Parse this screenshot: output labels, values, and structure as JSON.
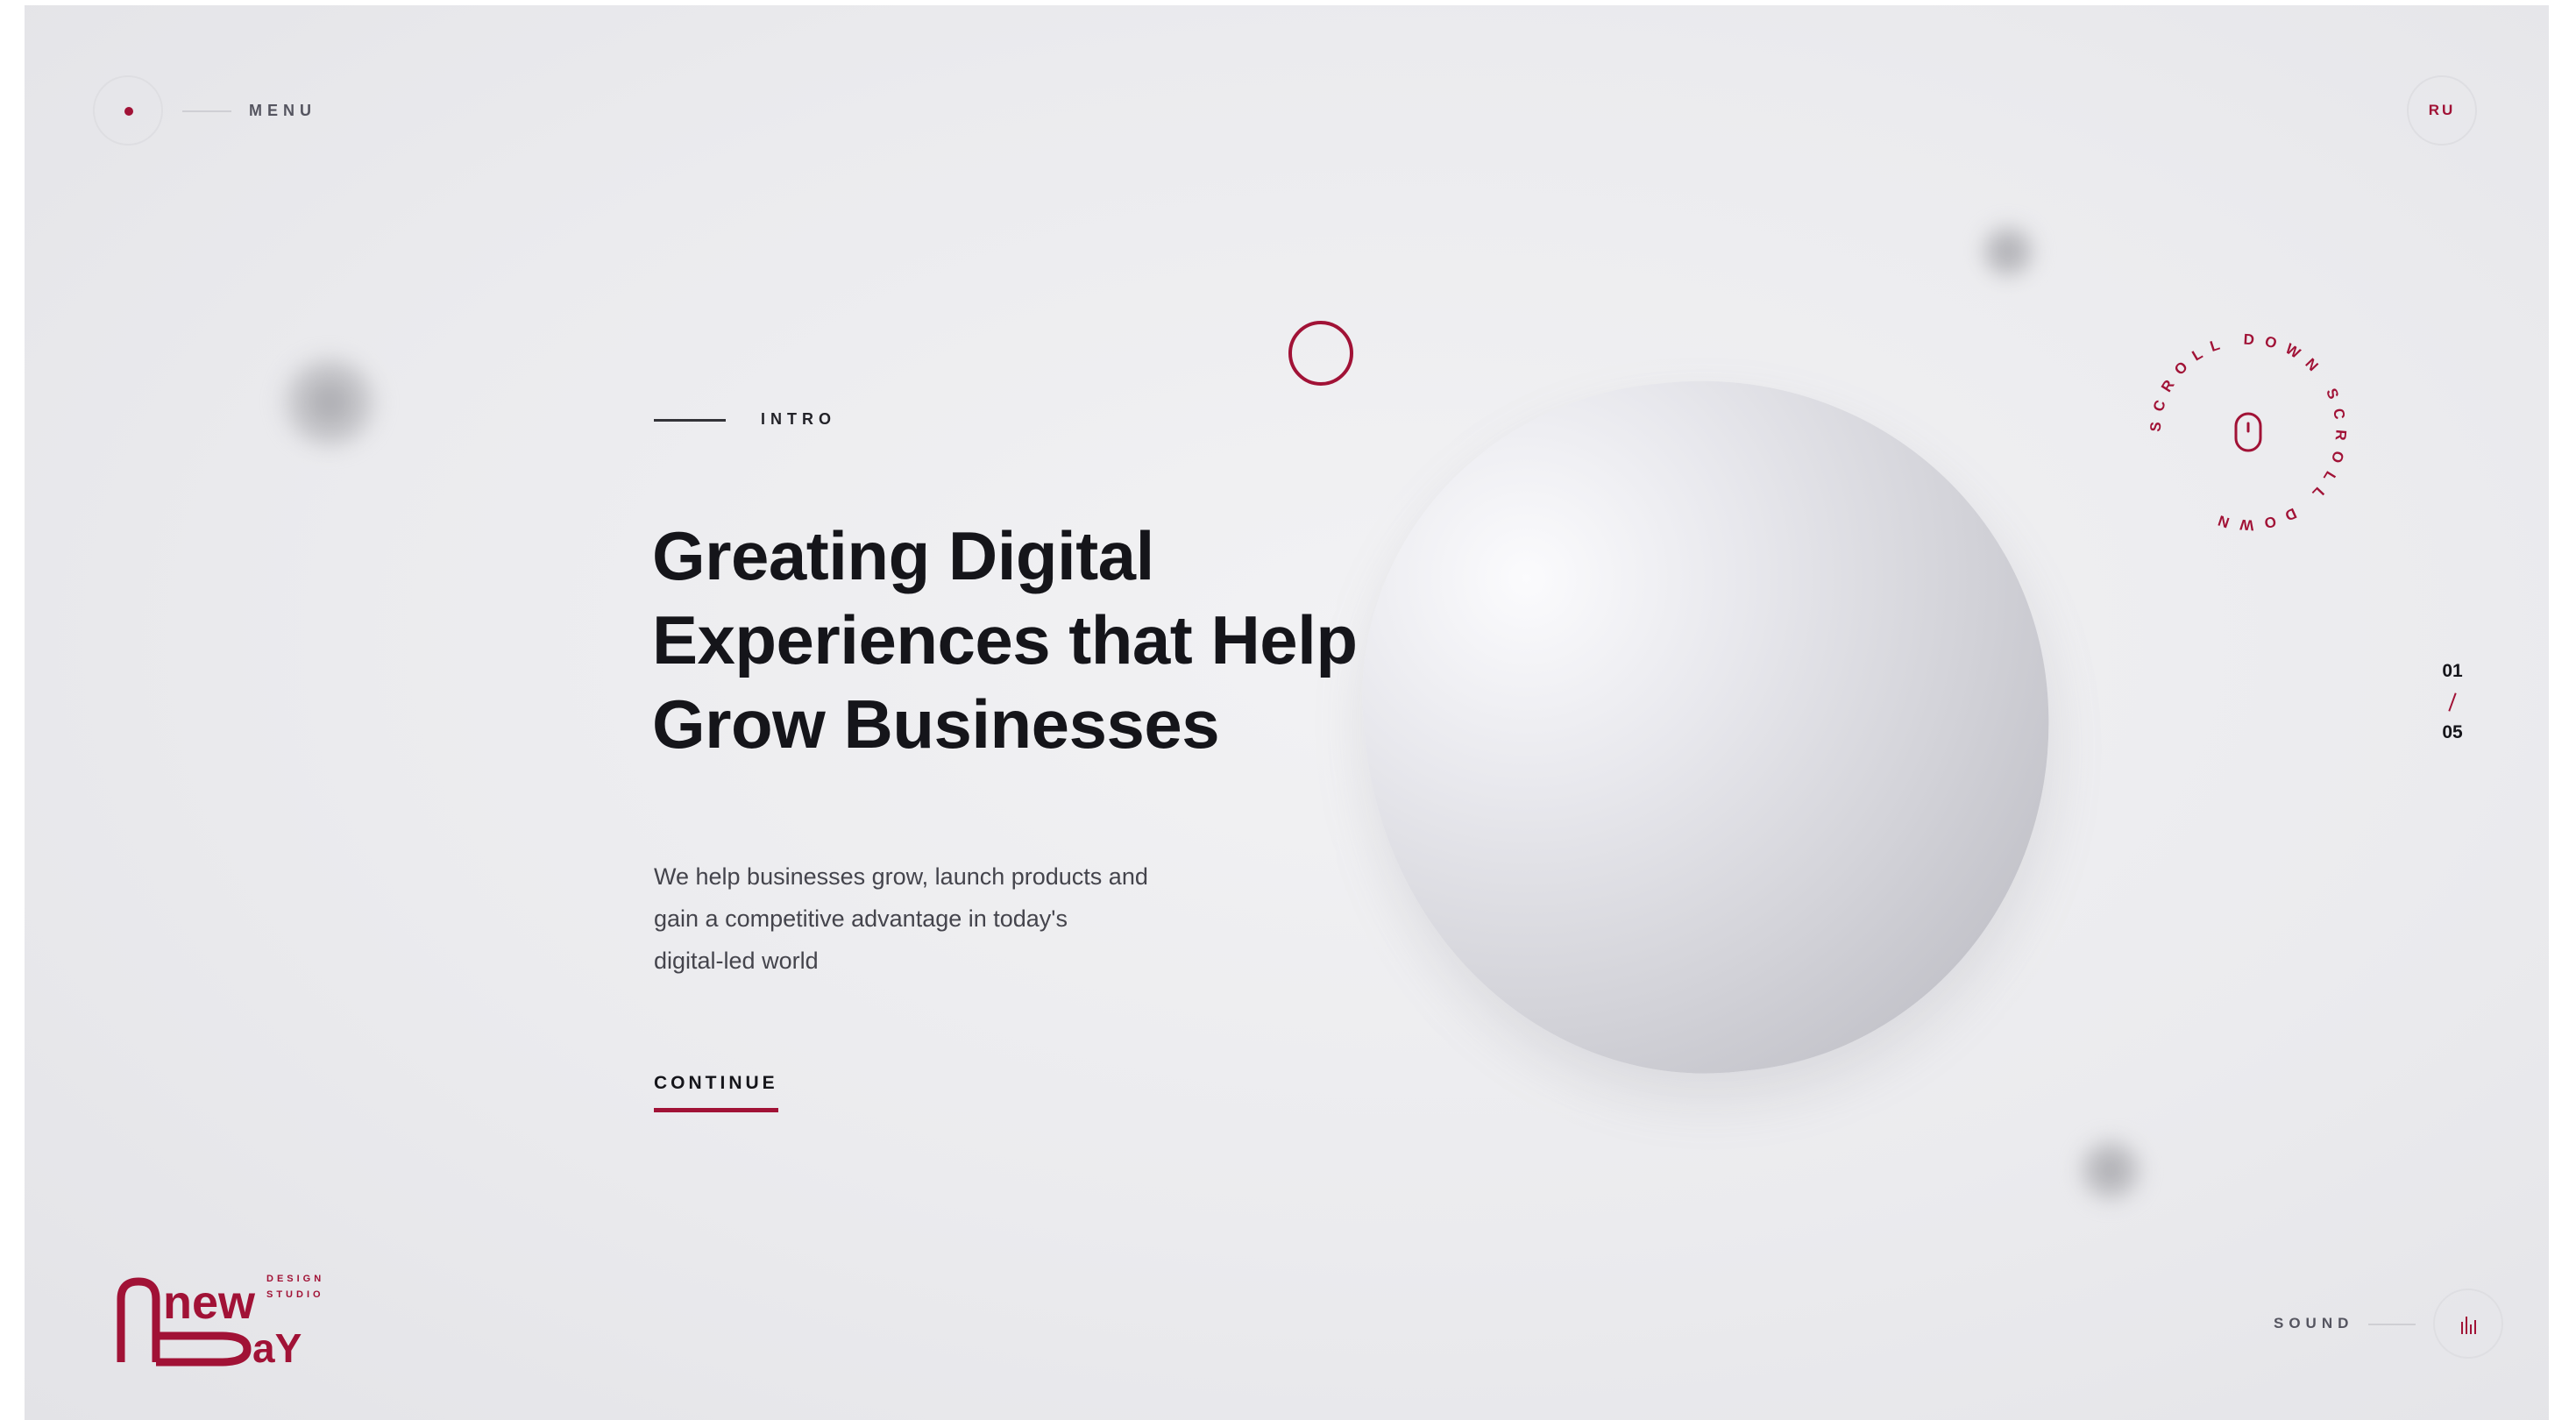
{
  "menu": {
    "label": "MENU"
  },
  "language": {
    "label": "RU"
  },
  "intro": {
    "eyebrow": "INTRO",
    "headline": [
      "Greating Digital",
      "Experiences that Help",
      "Grow Businesses"
    ],
    "description": [
      "We help businesses grow, launch products and",
      "gain a competitive advantage in today's",
      "digital-led world"
    ],
    "cta": "CONTINUE"
  },
  "scroll_badge": {
    "text": "SCROLL DOWN SCROLL DOWN",
    "icon": "mouse-icon"
  },
  "pager": {
    "current": "01",
    "separator": "/",
    "total": "05"
  },
  "logo": {
    "word_top": "new",
    "word_bottom": "Day",
    "tagline": [
      "DESIGN",
      "STUDIO"
    ]
  },
  "sound": {
    "label": "SOUND",
    "icon": "sound-bars-icon"
  },
  "colors": {
    "accent": "#a11236",
    "text": "#15151a",
    "background": "#ececef"
  }
}
